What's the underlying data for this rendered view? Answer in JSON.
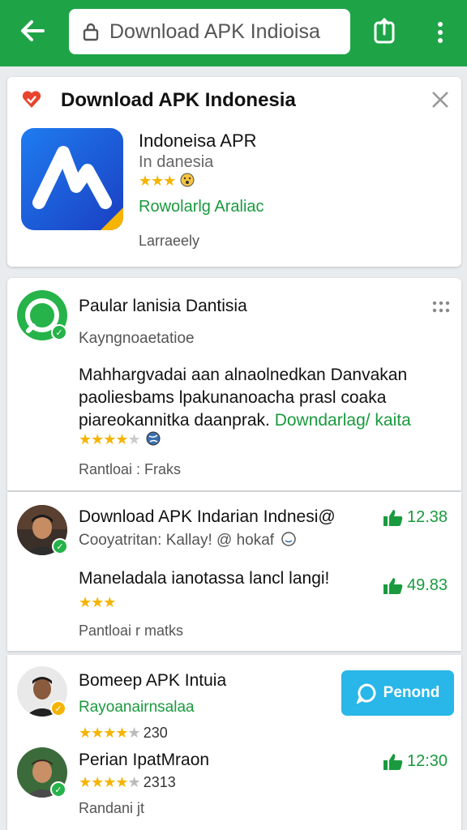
{
  "colors": {
    "topbar": "#1ea447",
    "accent_green": "#1a9a3e",
    "star": "#f5b400",
    "respond_button": "#29b6e8"
  },
  "topbar": {
    "url": "Download APK Indioisa",
    "icons": {
      "back": "back-arrow-icon",
      "lock": "lock-icon",
      "share": "share-icon",
      "menu": "more-vertical-icon"
    }
  },
  "banner": {
    "title": "Download APK Indonesia",
    "app_name": "Indoneisa APR",
    "app_sub": "In danesia",
    "stars": "★★★",
    "link": "Rowolarlg Araliac",
    "footer": "Larraeely",
    "icons": {
      "heart": "heart-icon",
      "close": "close-icon"
    }
  },
  "post": {
    "title": "Paular lanisia Dantisia",
    "subtitle": "Kayngnoaetatioe",
    "body_lines": [
      "Mahhargvadai aan alnaolnedkan Danvakan",
      "paoliesbams lpakunanoacha prasl coaka"
    ],
    "body_line3": "piareokannitka daanprak.",
    "body_link": "Downdarlag/ kaita",
    "stars": "★★★★",
    "footer": "Rantloai : Fraks"
  },
  "comments": [
    {
      "title": "Download APK Indarian Indnesi@",
      "subtitle": "Cooyatritan: Kallay! @ hokaf",
      "likes": "12.38",
      "body": "Maneladala ianotassa lancl langi!",
      "stars": "★★★",
      "likes2": "49.83",
      "footer": "Pantloai r matks"
    },
    {
      "title": "Bomeep APK Intuia",
      "subtitle": "Rayoanairnsalaa",
      "stars": "★★★★",
      "count": "230",
      "button": "Penond"
    },
    {
      "title": "Perian IpatMraon",
      "stars": "★★★★",
      "count": "2313",
      "likes": "12:30",
      "footer": "Randani jt"
    }
  ]
}
